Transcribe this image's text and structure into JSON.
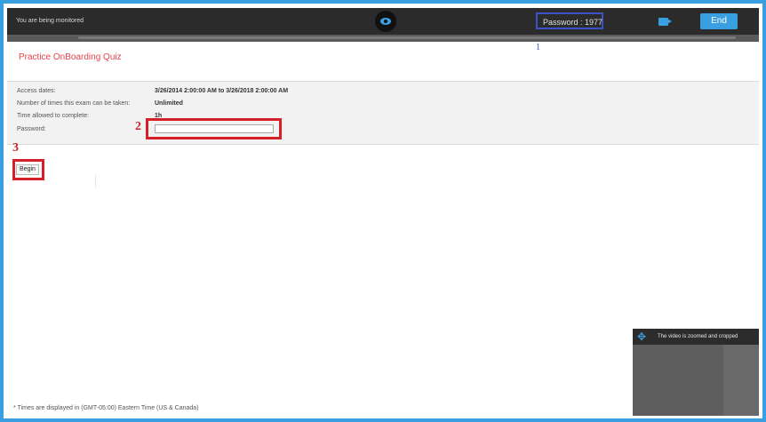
{
  "topbar": {
    "monitor_text": "You are being monitored",
    "password_display": "Password : 1977",
    "end_label": "End"
  },
  "annotations": {
    "one": "1",
    "two": "2",
    "three": "3"
  },
  "quiz": {
    "title": "Practice OnBoarding Quiz",
    "fields": [
      {
        "label": "Access dates:",
        "value": "3/26/2014 2:00:00 AM to 3/26/2018 2:00:00 AM"
      },
      {
        "label": "Number of times this exam can be taken:",
        "value": "Unlimited"
      },
      {
        "label": "Time allowed to complete:",
        "value": "1h"
      },
      {
        "label": "Password:"
      }
    ],
    "password_value": "",
    "begin_label": "Begin"
  },
  "footer": {
    "note": "* Times are displayed in (GMT-05:00) Eastern Time (US & Canada)"
  },
  "video": {
    "label": "The video is zoomed and cropped"
  },
  "colors": {
    "accent": "#3a9fe0",
    "annotation_red": "#d5202a",
    "annotation_blue": "#3d52c9",
    "title_red": "#e8434b"
  }
}
